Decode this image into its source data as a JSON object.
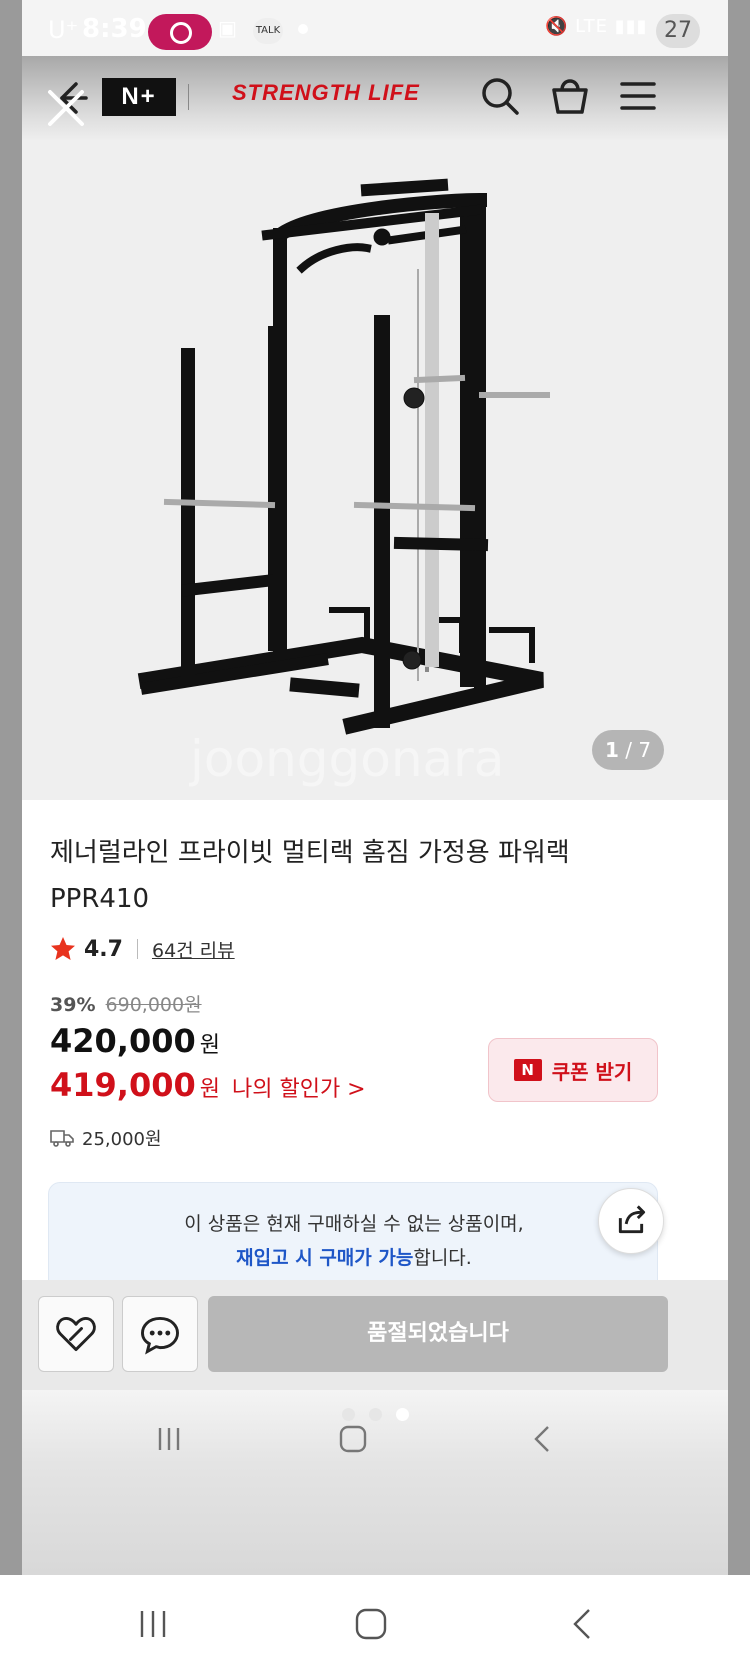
{
  "status_bar": {
    "carrier": "U⁺",
    "time": "8:39",
    "talk_badge": "TALK",
    "network": "LTE",
    "battery": "27"
  },
  "header": {
    "logo_text": "N+",
    "brand_text": "STRENGTH LIFE"
  },
  "gallery": {
    "current": "1",
    "total": "/ 7"
  },
  "product": {
    "title_line1": "제너럴라인 프라이빗 멀티랙 홈짐 가정용 파워랙",
    "title_line2": "PPR410",
    "rating": "4.7",
    "review_link": "64건 리뷰",
    "discount_rate": "39%",
    "original_price": "690,000원",
    "price": "420,000",
    "price_unit": "원",
    "my_price": "419,000",
    "my_price_unit": "원",
    "my_price_label": "나의 할인가 >",
    "coupon_badge": "N",
    "coupon_label": "쿠폰 받기",
    "shipping": "25,000원"
  },
  "notice": {
    "line1": "이 상품은 현재 구매하실 수 없는 상품이며,",
    "line2_highlight": "재입고 시 구매가 가능",
    "line2_rest": "합니다."
  },
  "actions": {
    "soldout_label": "품절되었습니다"
  },
  "watermark": "joonggonara",
  "colors": {
    "brand_red": "#d0101a",
    "link_blue": "#1e56c7",
    "disabled_gray": "#b7b7b7"
  }
}
